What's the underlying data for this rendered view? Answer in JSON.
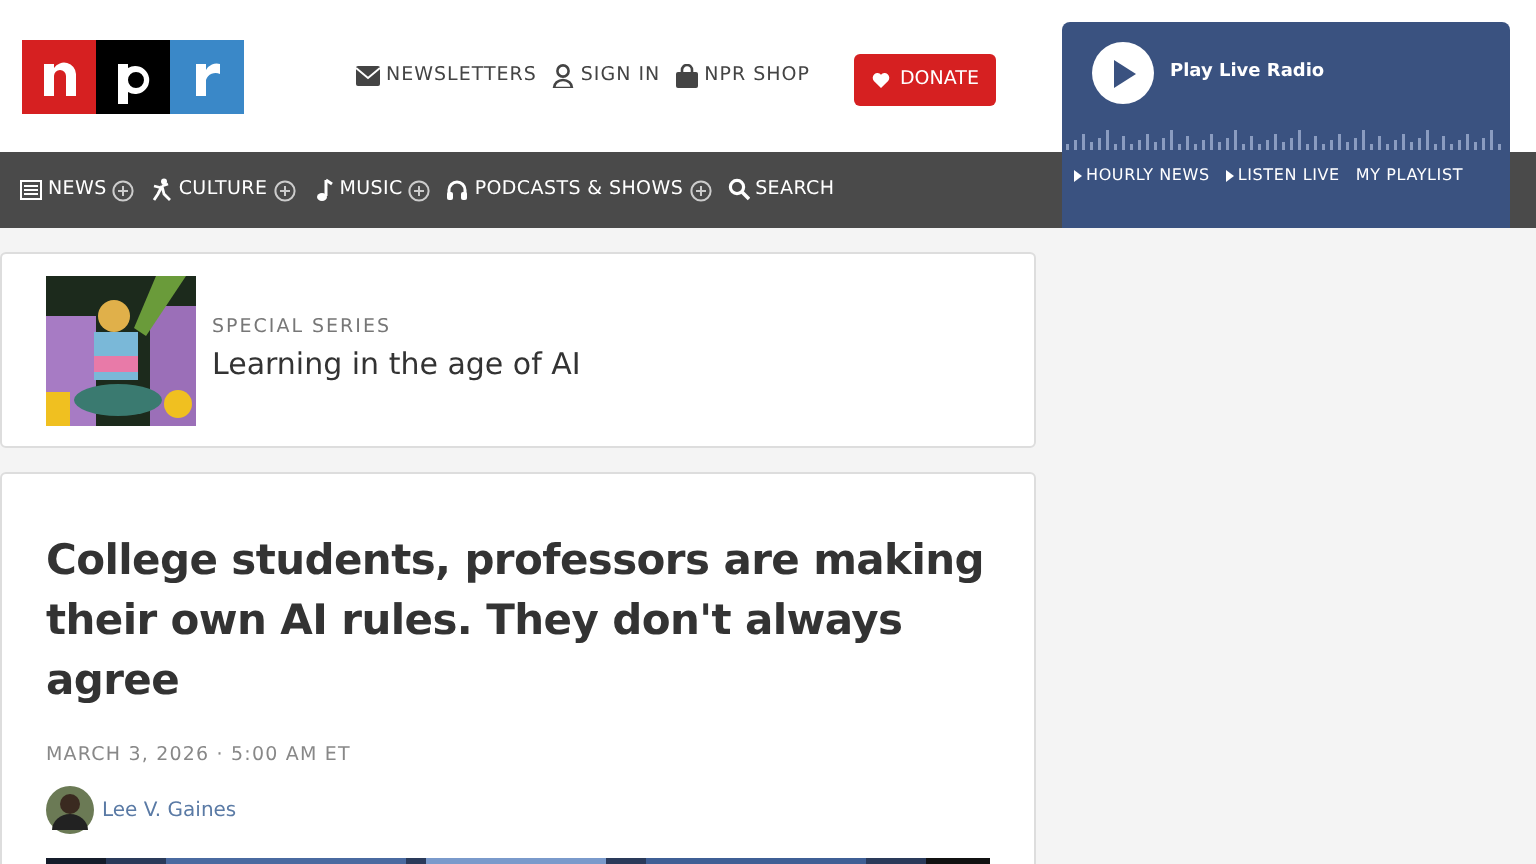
{
  "header": {
    "links": [
      {
        "label": "NEWSLETTERS"
      },
      {
        "label": "SIGN IN"
      },
      {
        "label": "NPR SHOP"
      }
    ],
    "donate": "DONATE"
  },
  "player": {
    "label": "Play Live Radio",
    "links": [
      {
        "label": "HOURLY NEWS",
        "kind": "play"
      },
      {
        "label": "LISTEN LIVE",
        "kind": "play"
      },
      {
        "label": "MY PLAYLIST",
        "kind": "plain"
      }
    ]
  },
  "nav": [
    {
      "label": "NEWS",
      "kind": "dropdown"
    },
    {
      "label": "CULTURE",
      "kind": "dropdown"
    },
    {
      "label": "MUSIC",
      "kind": "dropdown"
    },
    {
      "label": "PODCASTS & SHOWS",
      "kind": "dropdown"
    },
    {
      "label": "SEARCH",
      "kind": "link"
    }
  ],
  "series": {
    "eyebrow": "SPECIAL SERIES",
    "title": "Learning in the age of AI"
  },
  "article": {
    "headline": "College students, professors are making their own AI rules. They don't always agree",
    "date": "MARCH 3, 2026 · 5:00 AM ET",
    "author": "Lee V. Gaines"
  }
}
